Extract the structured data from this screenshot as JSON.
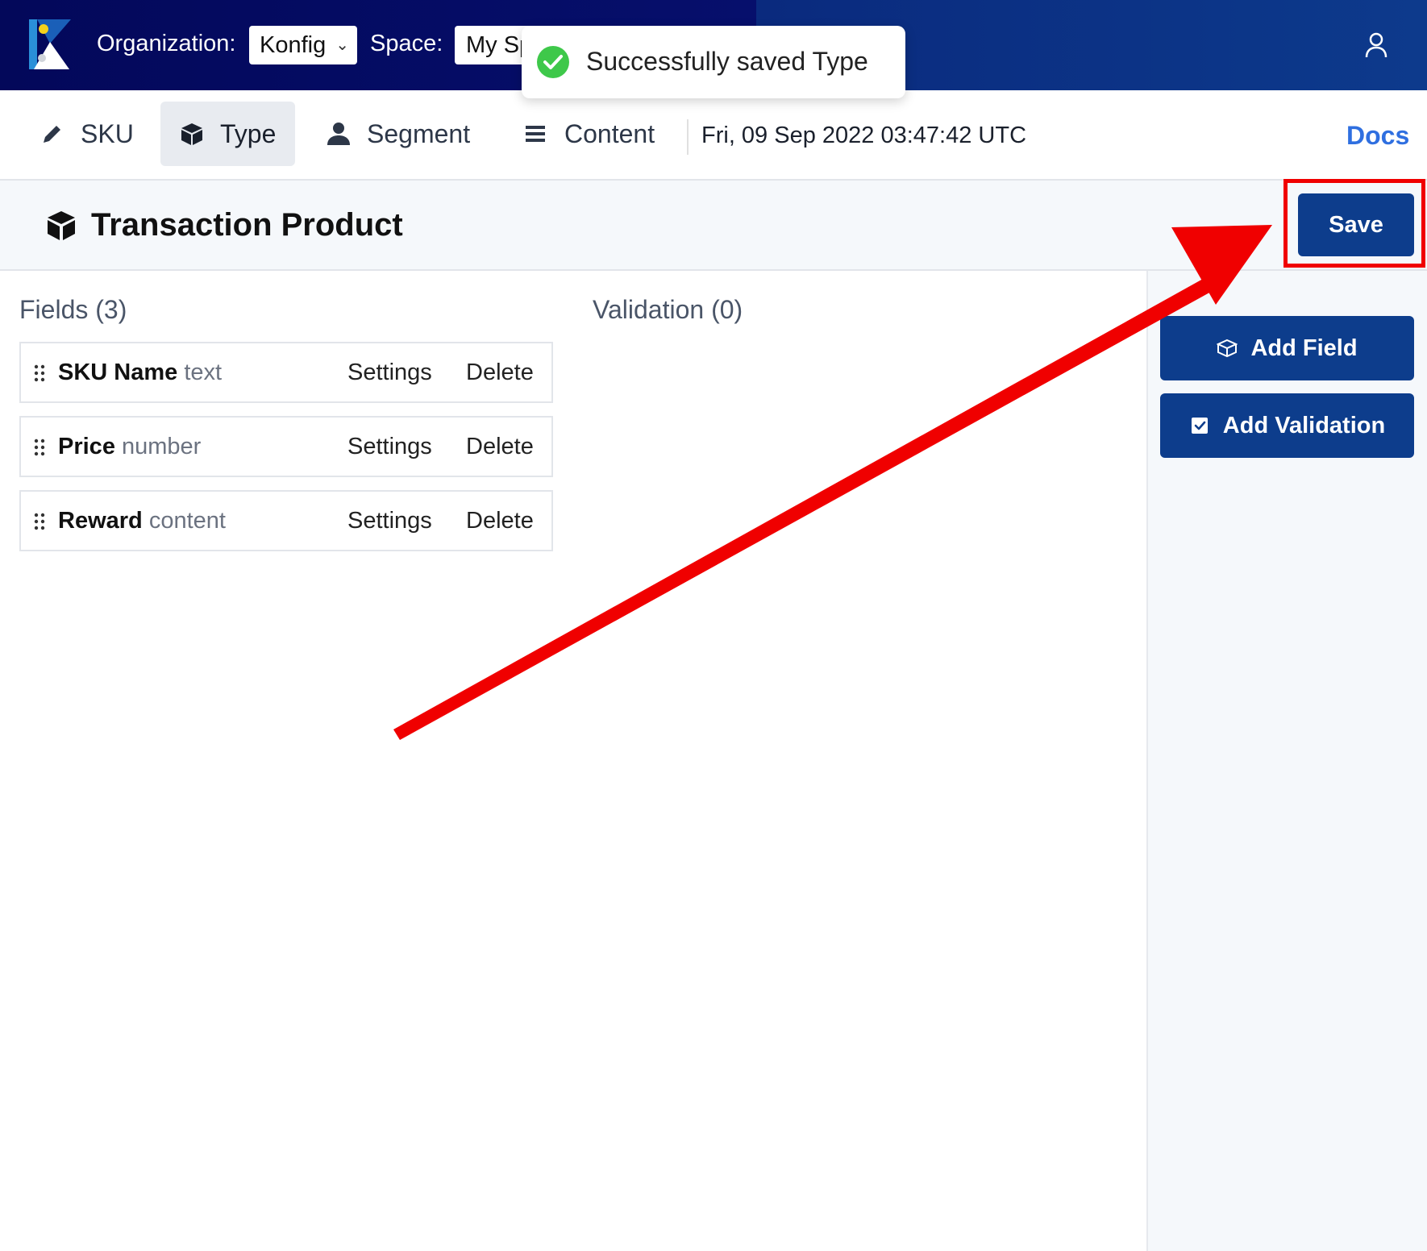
{
  "topbar": {
    "organization_label": "Organization:",
    "organization_value": "Konfig",
    "space_label": "Space:",
    "space_value": "My Space",
    "user_icon": "user-icon",
    "logo_icon": "konfig-logo"
  },
  "toast": {
    "message": "Successfully saved Type",
    "icon": "check-circle-icon"
  },
  "nav": {
    "tabs": [
      {
        "label": "SKU",
        "icon": "pencil-icon"
      },
      {
        "label": "Type",
        "icon": "cube-icon",
        "active": true
      },
      {
        "label": "Segment",
        "icon": "user-icon"
      },
      {
        "label": "Content",
        "icon": "list-icon"
      }
    ],
    "timestamp": "Fri, 09 Sep 2022 03:47:42 UTC",
    "docs_label": "Docs"
  },
  "header": {
    "title": "Transaction Product",
    "save_label": "Save"
  },
  "fields": {
    "title": "Fields (3)",
    "items": [
      {
        "name": "SKU Name",
        "type": "text",
        "settings": "Settings",
        "delete": "Delete"
      },
      {
        "name": "Price",
        "type": "number",
        "settings": "Settings",
        "delete": "Delete"
      },
      {
        "name": "Reward",
        "type": "content",
        "settings": "Settings",
        "delete": "Delete"
      }
    ]
  },
  "validation": {
    "title": "Validation (0)"
  },
  "sidebar": {
    "add_field_label": "Add Field",
    "add_validation_label": "Add Validation"
  },
  "colors": {
    "topbar": "#03085a",
    "primary_button": "#0d3d8c",
    "docs_link": "#2f6fe0",
    "annotation_red": "#f00000",
    "toast_check": "#3ec84a"
  }
}
